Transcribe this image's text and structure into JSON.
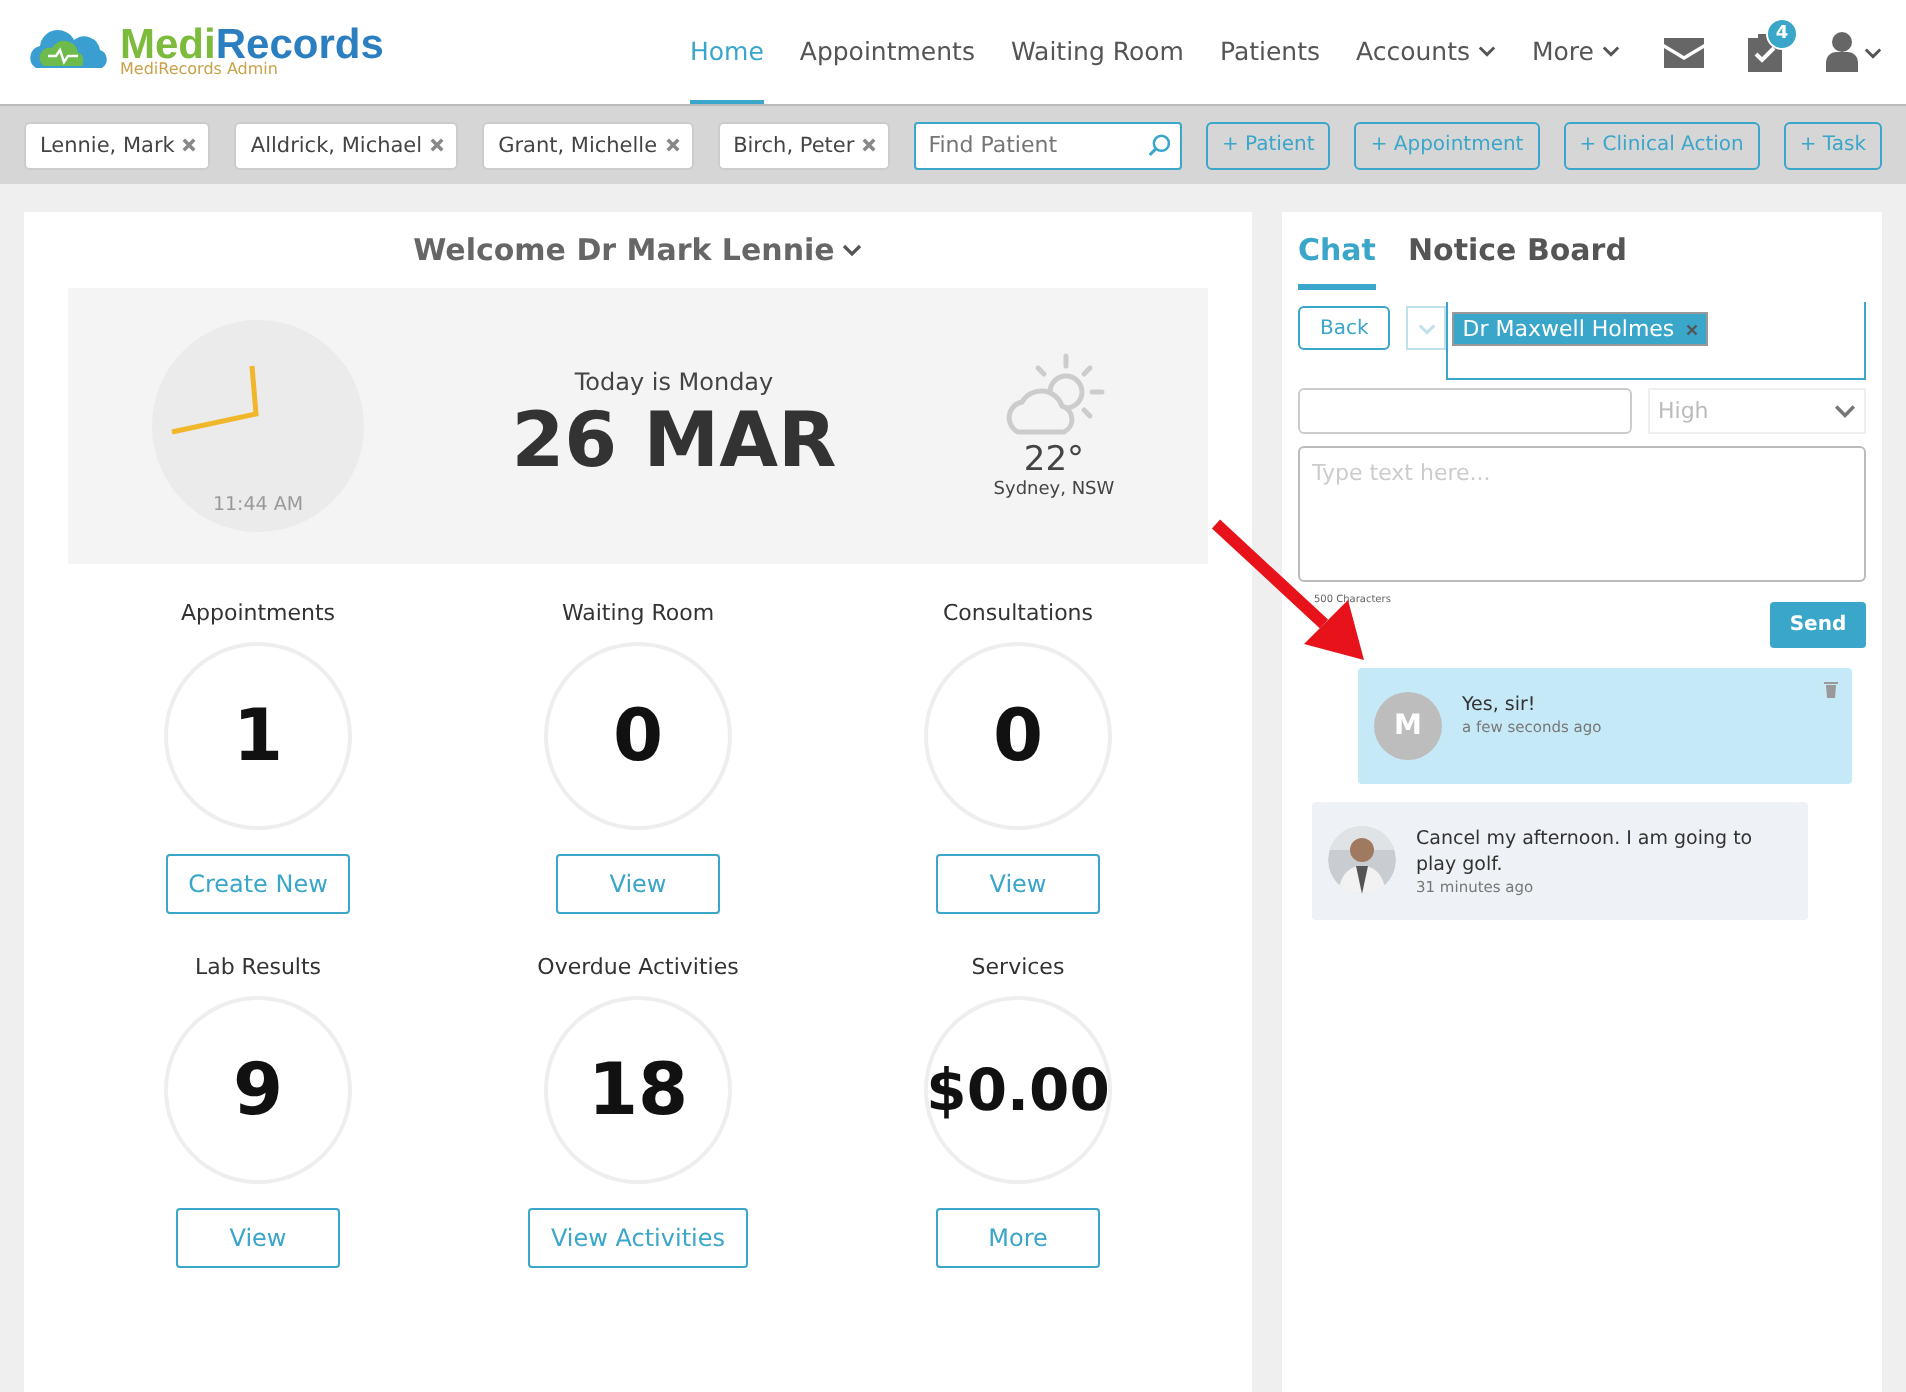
{
  "brand": {
    "name_first": "Medi",
    "name_second": "Records",
    "subtitle": "MediRecords Admin"
  },
  "nav": [
    {
      "label": "Home",
      "selected": true,
      "dropdown": false
    },
    {
      "label": "Appointments",
      "selected": false,
      "dropdown": false
    },
    {
      "label": "Waiting Room",
      "selected": false,
      "dropdown": false
    },
    {
      "label": "Patients",
      "selected": false,
      "dropdown": false
    },
    {
      "label": "Accounts",
      "selected": false,
      "dropdown": true
    },
    {
      "label": "More",
      "selected": false,
      "dropdown": true
    }
  ],
  "tasks_badge": "4",
  "patient_tabs": [
    {
      "label": "Lennie, Mark"
    },
    {
      "label": "Alldrick, Michael"
    },
    {
      "label": "Grant, Michelle"
    },
    {
      "label": "Birch, Peter"
    }
  ],
  "find_patient": {
    "placeholder": "Find Patient"
  },
  "quick_actions": [
    "+ Patient",
    "+ Appointment",
    "+ Clinical Action",
    "+ Task"
  ],
  "welcome": "Welcome Dr Mark Lennie",
  "today": {
    "time": "11:44 AM",
    "day_line": "Today is Monday",
    "date": "26 MAR",
    "temperature": "22°",
    "location": "Sydney, NSW"
  },
  "stats": [
    {
      "label": "Appointments",
      "value": "1",
      "action": "Create New"
    },
    {
      "label": "Waiting Room",
      "value": "0",
      "action": "View"
    },
    {
      "label": "Consultations",
      "value": "0",
      "action": "View"
    },
    {
      "label": "Lab Results",
      "value": "9",
      "action": "View"
    },
    {
      "label": "Overdue Activities",
      "value": "18",
      "action": "View Activities"
    },
    {
      "label": "Services",
      "value": "$0.00",
      "action": "More"
    }
  ],
  "side_tabs": [
    {
      "label": "Chat",
      "selected": true
    },
    {
      "label": "Notice Board",
      "selected": false
    }
  ],
  "chat": {
    "back": "Back",
    "recipient": "Dr Maxwell Holmes",
    "priority": "High",
    "message_placeholder": "Type text here...",
    "limit_note": "500 Characters",
    "send": "Send",
    "messages": [
      {
        "kind": "sent",
        "avatar_letter": "M",
        "text": "Yes, sir!",
        "time": "a few seconds ago"
      },
      {
        "kind": "received",
        "text": "Cancel my afternoon. I am going to play golf.",
        "time": "31 minutes ago"
      }
    ]
  }
}
